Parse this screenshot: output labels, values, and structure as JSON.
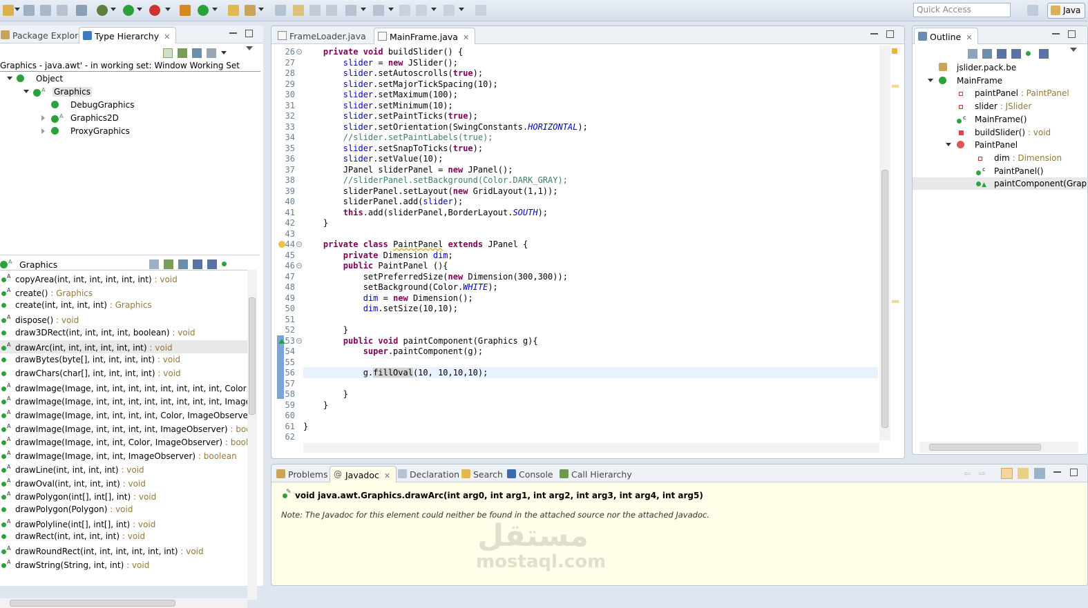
{
  "toolbar": {
    "quick_access_placeholder": "Quick Access",
    "perspective_label": "Java"
  },
  "type_hierarchy": {
    "tabs": [
      {
        "label": "Package Explorer",
        "active": false
      },
      {
        "label": "Type Hierarchy",
        "active": true
      }
    ],
    "scope_label": "Graphics - java.awt' - in working set: Window Working Set",
    "tree": [
      {
        "label": "Object",
        "level": 0,
        "icon": "class-icon"
      },
      {
        "label": "Graphics",
        "level": 1,
        "icon": "abstract-class-icon",
        "selected": true
      },
      {
        "label": "DebugGraphics",
        "level": 2,
        "icon": "class-icon"
      },
      {
        "label": "Graphics2D",
        "level": 2,
        "icon": "abstract-class-icon"
      },
      {
        "label": "ProxyGraphics",
        "level": 2,
        "icon": "class-icon"
      }
    ]
  },
  "members": {
    "title": "Graphics",
    "items": [
      {
        "name": "copyArea(int, int, int, int, int, int)",
        "type": ": void",
        "abstract": true
      },
      {
        "name": "create()",
        "type": ": Graphics",
        "abstract": true
      },
      {
        "name": "create(int, int, int, int)",
        "type": ": Graphics",
        "abstract": false
      },
      {
        "name": "dispose()",
        "type": ": void",
        "abstract": true
      },
      {
        "name": "draw3DRect(int, int, int, int, boolean)",
        "type": ": void",
        "abstract": false
      },
      {
        "name": "drawArc(int, int, int, int, int, int)",
        "type": ": void",
        "abstract": true,
        "selected": true
      },
      {
        "name": "drawBytes(byte[], int, int, int, int)",
        "type": ": void",
        "abstract": false
      },
      {
        "name": "drawChars(char[], int, int, int, int)",
        "type": ": void",
        "abstract": false
      },
      {
        "name": "drawImage(Image, int, int, int, int, int, int, int, int, Color, Imag",
        "type": "",
        "abstract": true
      },
      {
        "name": "drawImage(Image, int, int, int, int, int, int, int, int, ImageObse",
        "type": "",
        "abstract": true
      },
      {
        "name": "drawImage(Image, int, int, int, int, Color, ImageObserver)",
        "type": ": bo",
        "abstract": true
      },
      {
        "name": "drawImage(Image, int, int, int, int, ImageObserver)",
        "type": ": boolean",
        "abstract": true
      },
      {
        "name": "drawImage(Image, int, int, Color, ImageObserver)",
        "type": ": boolean",
        "abstract": true
      },
      {
        "name": "drawImage(Image, int, int, ImageObserver)",
        "type": ": boolean",
        "abstract": true
      },
      {
        "name": "drawLine(int, int, int, int)",
        "type": ": void",
        "abstract": true
      },
      {
        "name": "drawOval(int, int, int, int)",
        "type": ": void",
        "abstract": true
      },
      {
        "name": "drawPolygon(int[], int[], int)",
        "type": ": void",
        "abstract": true
      },
      {
        "name": "drawPolygon(Polygon)",
        "type": ": void",
        "abstract": false
      },
      {
        "name": "drawPolyline(int[], int[], int)",
        "type": ": void",
        "abstract": true
      },
      {
        "name": "drawRect(int, int, int, int)",
        "type": ": void",
        "abstract": false
      },
      {
        "name": "drawRoundRect(int, int, int, int, int, int)",
        "type": ": void",
        "abstract": true
      },
      {
        "name": "drawString(String, int, int)",
        "type": ": void",
        "abstract": true
      }
    ]
  },
  "editor": {
    "tabs": [
      {
        "label": "FrameLoader.java",
        "active": false
      },
      {
        "label": "MainFrame.java",
        "active": true
      }
    ],
    "lines": [
      {
        "n": "26",
        "html": "    <span class=\"kw\">private</span> <span class=\"kw\">void</span> buildSlider() {"
      },
      {
        "n": "27",
        "html": "        <span class=\"fld\">slider</span> = <span class=\"kw\">new</span> JSlider();"
      },
      {
        "n": "28",
        "html": "        <span class=\"fld\">slider</span>.setAutoscrolls(<span class=\"kw\">true</span>);"
      },
      {
        "n": "29",
        "html": "        <span class=\"fld\">slider</span>.setMajorTickSpacing(10);"
      },
      {
        "n": "30",
        "html": "        <span class=\"fld\">slider</span>.setMaximum(100);"
      },
      {
        "n": "31",
        "html": "        <span class=\"fld\">slider</span>.setMinimum(10);"
      },
      {
        "n": "32",
        "html": "        <span class=\"fld\">slider</span>.setPaintTicks(<span class=\"kw\">true</span>);"
      },
      {
        "n": "33",
        "html": "        <span class=\"fld\">slider</span>.setOrientation(SwingConstants.<span class=\"cst\">HORIZONTAL</span>);"
      },
      {
        "n": "34",
        "html": "        <span class=\"cmt\">//slider.setPaintLabels(true);</span>"
      },
      {
        "n": "35",
        "html": "        <span class=\"fld\">slider</span>.setSnapToTicks(<span class=\"kw\">true</span>);"
      },
      {
        "n": "36",
        "html": "        <span class=\"fld\">slider</span>.setValue(10);"
      },
      {
        "n": "37",
        "html": "        JPanel sliderPanel = <span class=\"kw\">new</span> JPanel();"
      },
      {
        "n": "38",
        "html": "        <span class=\"cmt\">//sliderPanel.setBackground(Color.DARK_GRAY);</span>"
      },
      {
        "n": "39",
        "html": "        sliderPanel.setLayout(<span class=\"kw\">new</span> GridLayout(1,1));"
      },
      {
        "n": "40",
        "html": "        sliderPanel.add(<span class=\"fld\">slider</span>);"
      },
      {
        "n": "41",
        "html": "        <span class=\"kw\">this</span>.add(sliderPanel,BorderLayout.<span class=\"cst\">SOUTH</span>);"
      },
      {
        "n": "42",
        "html": "    }"
      },
      {
        "n": "43",
        "html": ""
      },
      {
        "n": "44",
        "html": "    <span class=\"kw\">private</span> <span class=\"kw\">class</span> <span style=\"text-decoration:underline wavy #d4a21a\">PaintPanel</span> <span class=\"kw\">extends</span> JPanel {"
      },
      {
        "n": "45",
        "html": "        <span class=\"kw\">private</span> Dimension <span class=\"fld\">dim</span>;"
      },
      {
        "n": "46",
        "html": "        <span class=\"kw\">public</span> PaintPanel (){"
      },
      {
        "n": "47",
        "html": "            setPreferredSize(<span class=\"kw\">new</span> Dimension(300,300));"
      },
      {
        "n": "48",
        "html": "            setBackground(Color.<span class=\"cst\">WHITE</span>);"
      },
      {
        "n": "49",
        "html": "            <span class=\"fld\">dim</span> = <span class=\"kw\">new</span> Dimension();"
      },
      {
        "n": "50",
        "html": "            <span class=\"fld\">dim</span>.setSize(10,10);"
      },
      {
        "n": "51",
        "html": ""
      },
      {
        "n": "52",
        "html": "        }"
      },
      {
        "n": "53",
        "html": "        <span class=\"kw\">public</span> <span class=\"kw\">void</span> paintComponent(Graphics g){"
      },
      {
        "n": "54",
        "html": "            <span class=\"kw\">super</span>.paintComponent(g);"
      },
      {
        "n": "55",
        "html": ""
      },
      {
        "n": "56",
        "html": "            g.<span style=\"background:#d4d4d4\">fillOval</span>(10, 10,10,10);"
      },
      {
        "n": "57",
        "html": ""
      },
      {
        "n": "58",
        "html": "        }"
      },
      {
        "n": "59",
        "html": "    }"
      },
      {
        "n": "60",
        "html": ""
      },
      {
        "n": "61",
        "html": "}"
      },
      {
        "n": "62",
        "html": ""
      }
    ]
  },
  "outline": {
    "tab_label": "Outline",
    "items": [
      {
        "label": "jslider.pack.be",
        "type": "",
        "level": 0,
        "icon": "package-icon"
      },
      {
        "label": "MainFrame",
        "type": "",
        "level": 0,
        "icon": "class-icon",
        "expanded": true
      },
      {
        "label": "paintPanel",
        "type": ": PaintPanel",
        "level": 1,
        "icon": "private-field-icon"
      },
      {
        "label": "slider",
        "type": ": JSlider",
        "level": 1,
        "icon": "private-field-icon"
      },
      {
        "label": "MainFrame()",
        "type": "",
        "level": 1,
        "icon": "constructor-icon"
      },
      {
        "label": "buildSlider()",
        "type": ": void",
        "level": 1,
        "icon": "private-method-icon"
      },
      {
        "label": "PaintPanel",
        "type": "",
        "level": 1,
        "icon": "inner-class-icon",
        "expanded": true
      },
      {
        "label": "dim",
        "type": ": Dimension",
        "level": 2,
        "icon": "private-field-icon"
      },
      {
        "label": "PaintPanel()",
        "type": "",
        "level": 2,
        "icon": "constructor-icon"
      },
      {
        "label": "paintComponent(Graph",
        "type": "",
        "level": 2,
        "icon": "override-method-icon",
        "selected": true
      }
    ]
  },
  "bottom": {
    "tabs": [
      {
        "label": "Problems",
        "active": false
      },
      {
        "label": "Javadoc",
        "active": true
      },
      {
        "label": "Declaration",
        "active": false
      },
      {
        "label": "Search",
        "active": false
      },
      {
        "label": "Console",
        "active": false
      },
      {
        "label": "Call Hierarchy",
        "active": false
      }
    ],
    "signature": "void java.awt.Graphics.drawArc(int arg0, int arg1, int arg2, int arg3, int arg4, int arg5)",
    "note": "Note: The Javadoc for this element could neither be found in the attached source nor the attached Javadoc.",
    "watermark_logo": "مستقل",
    "watermark_text": "mostaql.com"
  },
  "colors": {
    "accent": "#2aa13a",
    "javadoc_bg": "#fffee8",
    "selection": "#e8e8e8"
  }
}
